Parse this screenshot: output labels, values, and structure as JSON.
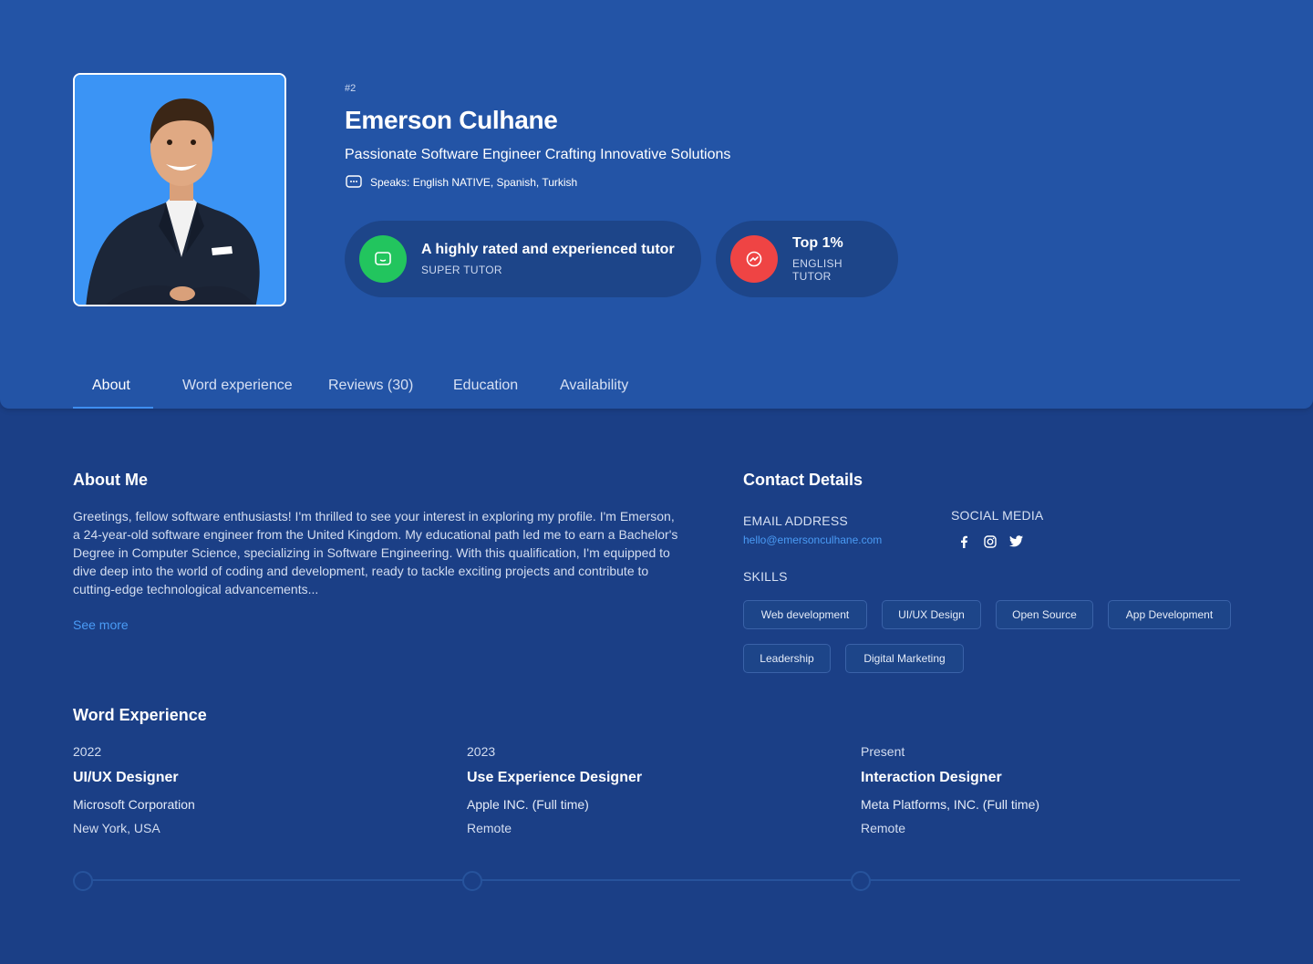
{
  "profile": {
    "rank": "#2",
    "name": "Emerson Culhane",
    "headline": "Passionate Software Engineer Crafting Innovative Solutions",
    "speaks": "Speaks: English NATIVE, Spanish, Turkish"
  },
  "badges": [
    {
      "title": "A highly rated and experienced tutor",
      "subtitle": "SUPER TUTOR",
      "color": "#22c55e",
      "icon": "chat-icon"
    },
    {
      "title": "Top 1%",
      "subtitle": "ENGLISH TUTOR",
      "color": "#ef4444",
      "icon": "trend-icon"
    }
  ],
  "tabs": [
    "About",
    "Word experience",
    "Reviews (30)",
    "Education",
    "Availability"
  ],
  "active_tab": "About",
  "about": {
    "title": "About Me",
    "text": "Greetings, fellow software enthusiasts! I'm thrilled to see your interest in exploring my profile. I'm Emerson, a 24-year-old software engineer from the United Kingdom. My educational path led me to earn a Bachelor's Degree in Computer Science, specializing in Software Engineering. With this qualification, I'm equipped to dive deep into the world of coding and development, ready to tackle exciting projects and contribute to cutting-edge technological advancements...",
    "see_more": "See more"
  },
  "contact": {
    "title": "Contact Details",
    "email_label": "EMAIL ADDRESS",
    "email": "hello@emersonculhane.com",
    "social_label": "SOCIAL MEDIA",
    "socials": [
      "facebook-icon",
      "instagram-icon",
      "twitter-icon"
    ],
    "skills_label": "SKILLS",
    "skills": [
      "Web development",
      "UI/UX Design",
      "Open Source",
      "App Development",
      "Leadership",
      "Digital Marketing"
    ]
  },
  "experience": {
    "title": "Word Experience",
    "items": [
      {
        "year": "2022",
        "role": "UI/UX Designer",
        "company": "Microsoft Corporation",
        "location": "New York, USA"
      },
      {
        "year": "2023",
        "role": "Use Experience Designer",
        "company": "Apple INC. (Full time)",
        "location": "Remote"
      },
      {
        "year": "Present",
        "role": "Interaction Designer",
        "company": "Meta Platforms, INC. (Full time)",
        "location": "Remote"
      }
    ]
  },
  "colors": {
    "accent": "#3e8ef0",
    "link": "#4a9bf5",
    "hero_bg": "#2354a6",
    "page_bg": "#1b3f86"
  }
}
